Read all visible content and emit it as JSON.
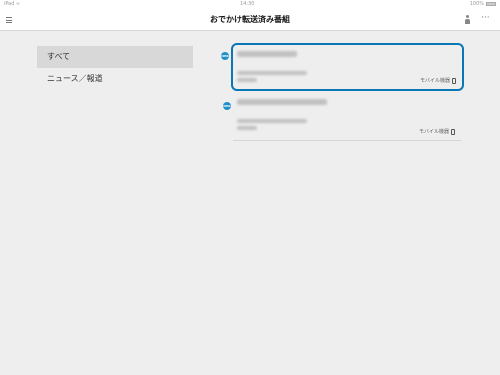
{
  "status_bar": {
    "carrier": "iPad ≈",
    "time": "14:30",
    "battery": "100%"
  },
  "header": {
    "title": "おでかけ転送済み番組"
  },
  "sidebar": {
    "items": [
      {
        "label": "すべて"
      },
      {
        "label": "ニュース／報道"
      }
    ]
  },
  "programs": [
    {
      "badge": "NHK",
      "device_label": "モバイル機器"
    },
    {
      "badge": "NHK",
      "device_label": "モバイル機器"
    }
  ],
  "colors": {
    "accent": "#0a77b5",
    "badge": "#1f90c7"
  },
  "icons": {
    "menu": "hamburger-icon",
    "user": "person-icon",
    "more": "more-icon",
    "device": "phone-icon"
  }
}
